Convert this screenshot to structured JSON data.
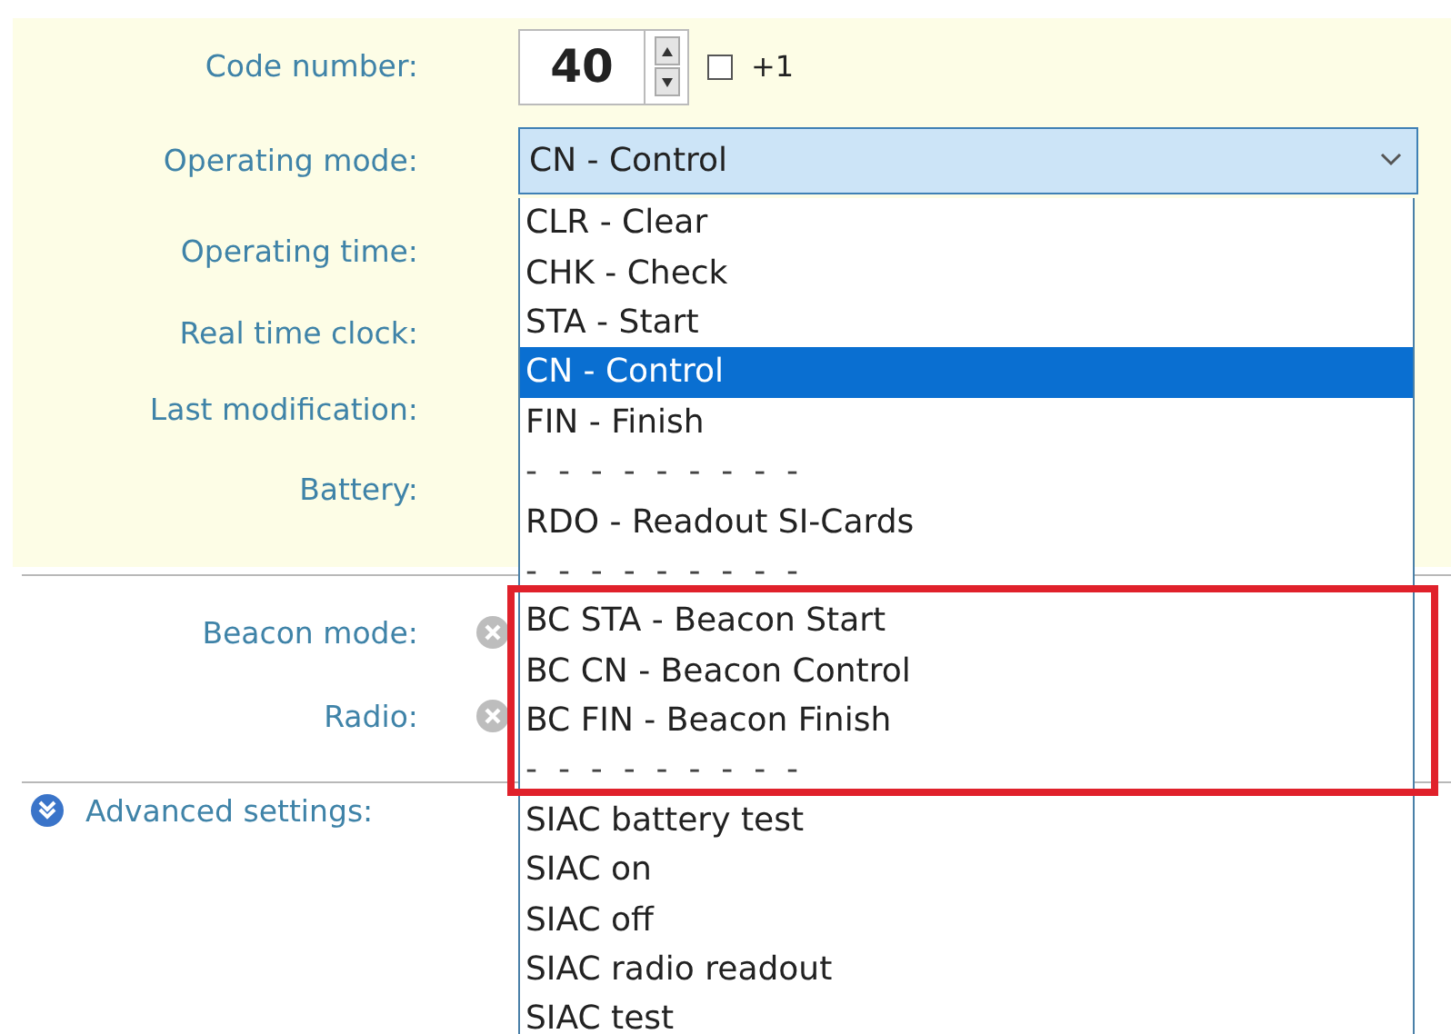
{
  "settings": {
    "code_number": {
      "label": "Code number:",
      "value": "40",
      "plus_one": {
        "label": "+1",
        "checked": false
      }
    },
    "operating_mode": {
      "label": "Operating mode:",
      "value": "CN - Control",
      "expanded": true
    },
    "labels": [
      "Operating time:",
      "Real time clock:",
      "Last modification:",
      "Battery:"
    ]
  },
  "radio_section": [
    {
      "label": "Beacon mode:"
    },
    {
      "label": "Radio:"
    }
  ],
  "advanced": {
    "label": "Advanced settings:",
    "expanded": false
  },
  "dropdown": [
    {
      "kind": "option",
      "text": "CLR - Clear",
      "selected": false
    },
    {
      "kind": "option",
      "text": "CHK - Check",
      "selected": false
    },
    {
      "kind": "option",
      "text": "STA - Start",
      "selected": false
    },
    {
      "kind": "option",
      "text": "CN - Control",
      "selected": true
    },
    {
      "kind": "option",
      "text": "FIN - Finish",
      "selected": false
    },
    {
      "kind": "separator",
      "text": "-  -  -  -  -  -  -  -  -",
      "selected": false
    },
    {
      "kind": "option",
      "text": "RDO - Readout SI-Cards",
      "selected": false
    },
    {
      "kind": "separator",
      "text": "-  -  -  -  -  -  -  -  -",
      "selected": false
    },
    {
      "kind": "option",
      "text": "BC STA - Beacon Start",
      "selected": false
    },
    {
      "kind": "option",
      "text": "BC CN - Beacon Control",
      "selected": false
    },
    {
      "kind": "option",
      "text": "BC FIN - Beacon Finish",
      "selected": false
    },
    {
      "kind": "separator",
      "text": "-  -  -  -  -  -  -  -  -",
      "selected": false
    },
    {
      "kind": "option",
      "text": "SIAC battery test",
      "selected": false
    },
    {
      "kind": "option",
      "text": "SIAC on",
      "selected": false
    },
    {
      "kind": "option",
      "text": "SIAC off",
      "selected": false
    },
    {
      "kind": "option",
      "text": "SIAC radio readout",
      "selected": false
    },
    {
      "kind": "option",
      "text": "SIAC test",
      "selected": false
    }
  ]
}
